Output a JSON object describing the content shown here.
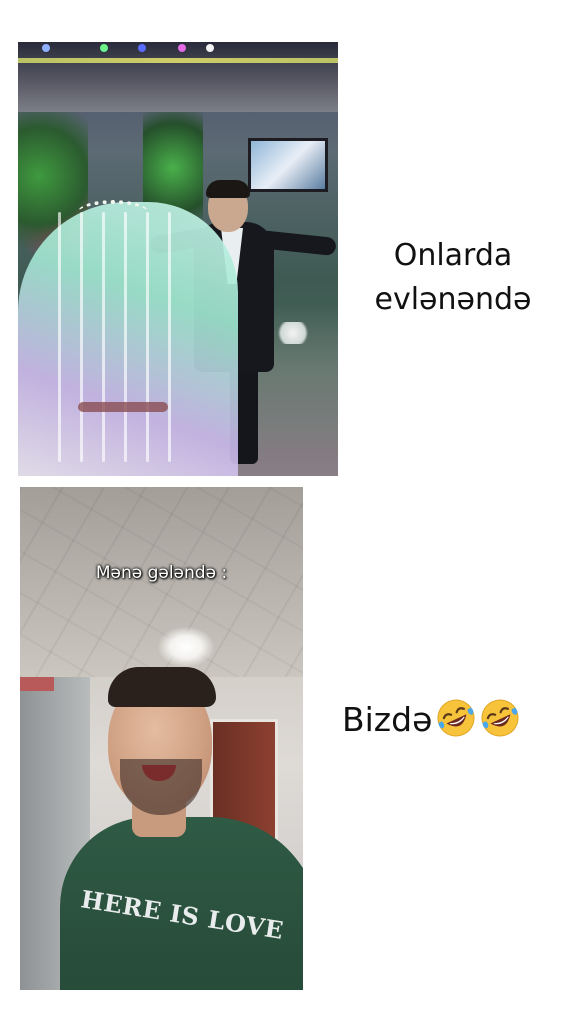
{
  "top_panel": {
    "caption": "Onlarda evlənəndə"
  },
  "bottom_panel": {
    "overlay_text": "Mənə gələndə :",
    "shirt_text": "HERE IS LOVE",
    "caption": "Bizdə",
    "emoji": [
      "rolling-on-floor-laughing-emoji",
      "rolling-on-floor-laughing-emoji"
    ]
  }
}
